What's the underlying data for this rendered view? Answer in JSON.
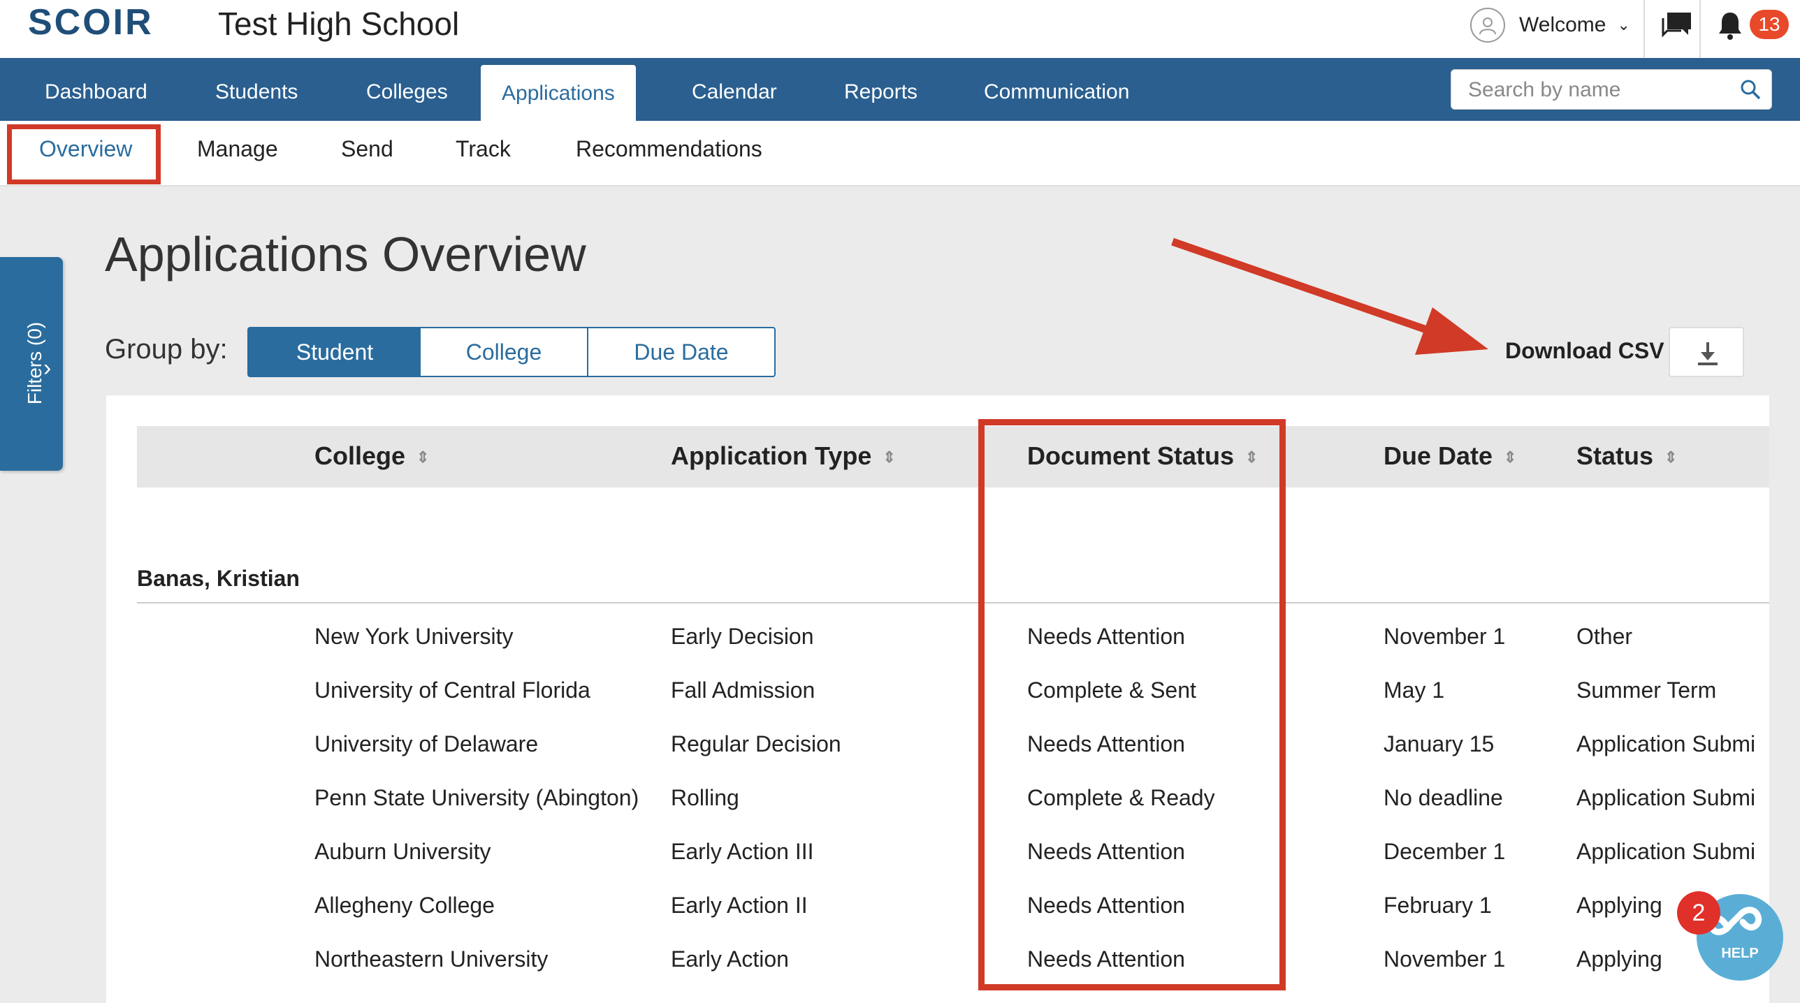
{
  "header": {
    "logo": "SCOIR",
    "school_name": "Test High School",
    "welcome": "Welcome",
    "notification_count": "13"
  },
  "main_nav": {
    "items": [
      "Dashboard",
      "Students",
      "Colleges",
      "Applications",
      "Calendar",
      "Reports",
      "Communication"
    ],
    "active": "Applications",
    "search_placeholder": "Search by name"
  },
  "sub_nav": {
    "items": [
      "Overview",
      "Manage",
      "Send",
      "Track",
      "Recommendations"
    ],
    "active": "Overview"
  },
  "filters": {
    "label": "Filters (0)"
  },
  "page": {
    "title": "Applications Overview",
    "group_by_label": "Group by:",
    "group_by_options": [
      "Student",
      "College",
      "Due Date"
    ],
    "group_by_selected": "Student",
    "download_label": "Download CSV"
  },
  "table": {
    "columns": [
      "College",
      "Application Type",
      "Document Status",
      "Due Date",
      "Status"
    ],
    "group_name": "Banas, Kristian",
    "rows": [
      {
        "college": "New York University",
        "type": "Early Decision",
        "doc_status": "Needs Attention",
        "due": "November 1",
        "status": "Other"
      },
      {
        "college": "University of Central Florida",
        "type": "Fall Admission",
        "doc_status": "Complete & Sent",
        "due": "May 1",
        "status": "Summer Term"
      },
      {
        "college": "University of Delaware",
        "type": "Regular Decision",
        "doc_status": "Needs Attention",
        "due": "January 15",
        "status": "Application Submi"
      },
      {
        "college": "Penn State University (Abington)",
        "type": "Rolling",
        "doc_status": "Complete & Ready",
        "due": "No deadline",
        "status": "Application Submi"
      },
      {
        "college": "Auburn University",
        "type": "Early Action III",
        "doc_status": "Needs Attention",
        "due": "December 1",
        "status": "Application Submi"
      },
      {
        "college": "Allegheny College",
        "type": "Early Action II",
        "doc_status": "Needs Attention",
        "due": "February 1",
        "status": "Applying"
      },
      {
        "college": "Northeastern University",
        "type": "Early Action",
        "doc_status": "Needs Attention",
        "due": "November 1",
        "status": "Applying"
      }
    ]
  },
  "help": {
    "label": "HELP",
    "badge": "2"
  },
  "colors": {
    "brand": "#2a5f8f",
    "accent": "#2a6c9e",
    "annotation": "#d03a27",
    "badge": "#e8492a"
  }
}
